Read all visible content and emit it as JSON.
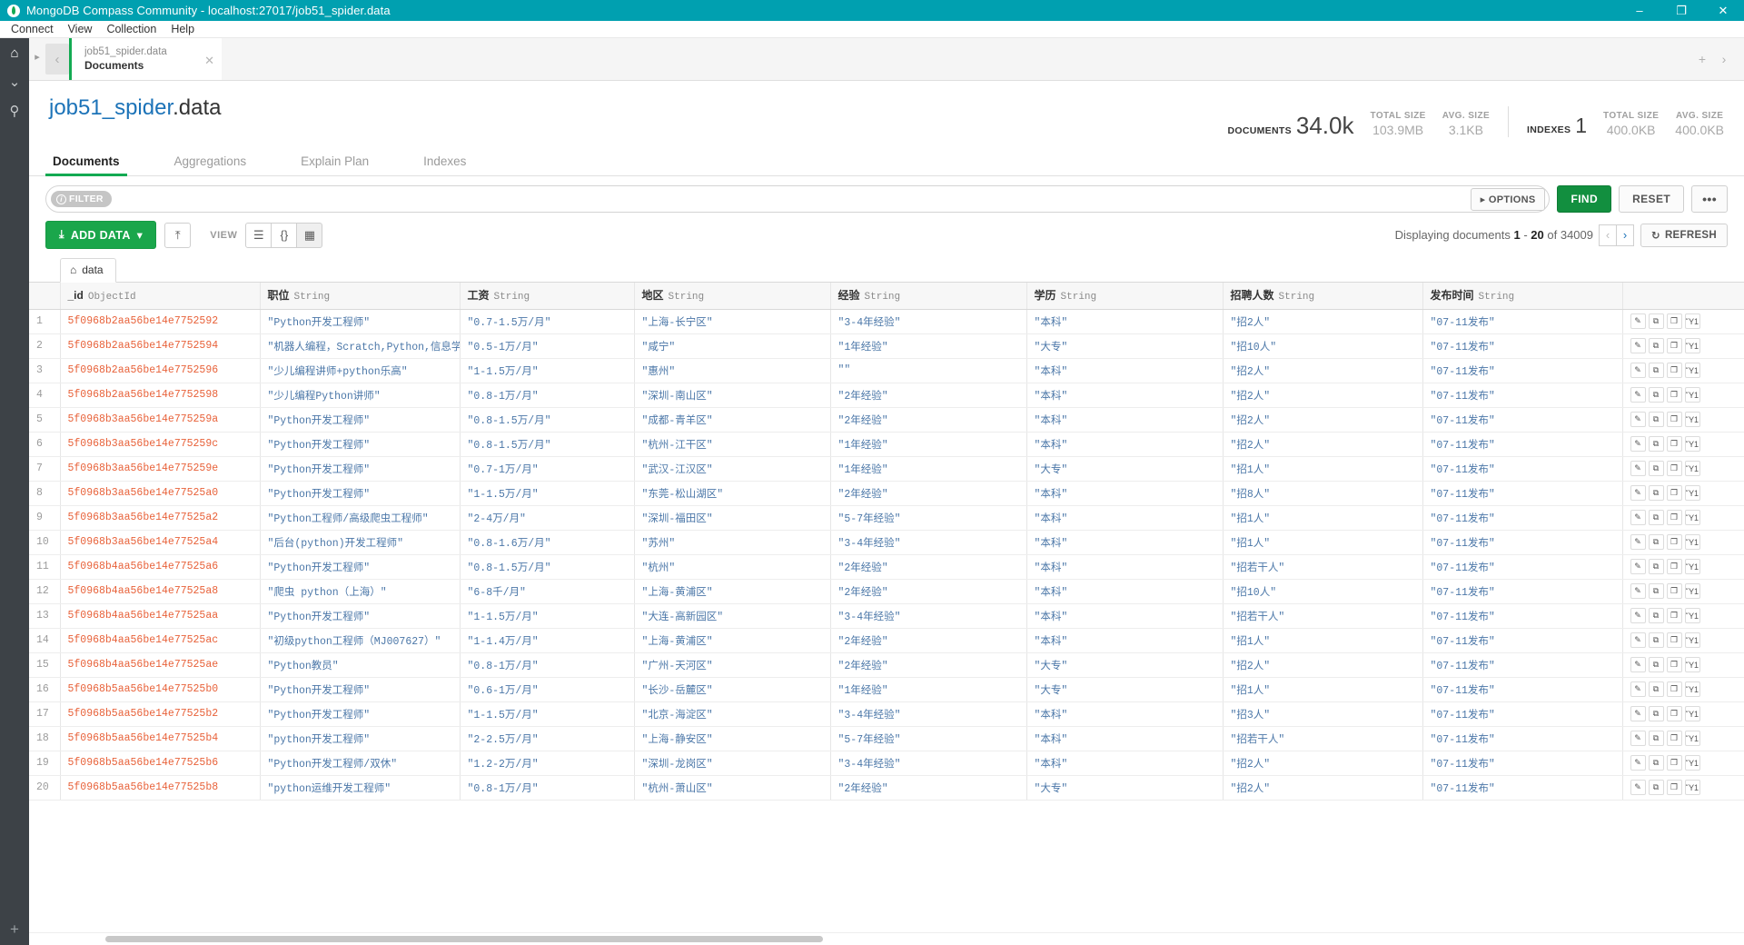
{
  "window": {
    "title": "MongoDB Compass Community - localhost:27017/job51_spider.data",
    "minimize": "–",
    "maximize": "❐",
    "close": "✕"
  },
  "menubar": {
    "items": [
      "Connect",
      "View",
      "Collection",
      "Help"
    ]
  },
  "rail": {
    "home_icon": "⌂",
    "chevron_icon": "⌄",
    "search_icon": "⚲",
    "plus_icon": "+"
  },
  "tabstrip": {
    "nav_forward_icon": "▸",
    "back_icon": "‹",
    "tab": {
      "namespace": "job51_spider.data",
      "subview": "Documents",
      "close_icon": "✕"
    },
    "right_add_icon": "+",
    "right_next_icon": "›"
  },
  "collection": {
    "db": "job51_spider",
    "coll": ".data",
    "stats": {
      "documents_label": "DOCUMENTS",
      "documents_value": "34.0k",
      "doc_total_size_label": "TOTAL SIZE",
      "doc_total_size_value": "103.9MB",
      "doc_avg_size_label": "AVG. SIZE",
      "doc_avg_size_value": "3.1KB",
      "indexes_label": "INDEXES",
      "indexes_value": "1",
      "idx_total_size_label": "TOTAL SIZE",
      "idx_total_size_value": "400.0KB",
      "idx_avg_size_label": "AVG. SIZE",
      "idx_avg_size_value": "400.0KB"
    }
  },
  "view_tabs": [
    {
      "label": "Documents",
      "active": true
    },
    {
      "label": "Aggregations",
      "active": false
    },
    {
      "label": "Explain Plan",
      "active": false
    },
    {
      "label": "Indexes",
      "active": false
    }
  ],
  "query_bar": {
    "filter_badge": "FILTER",
    "filter_info_icon": "i",
    "filter_value": "",
    "filter_placeholder": "",
    "options_label": "OPTIONS",
    "options_caret": "▸",
    "find_label": "FIND",
    "reset_label": "RESET",
    "more_label": "•••"
  },
  "toolbar": {
    "add_data_label": "ADD DATA",
    "add_data_icon": "⤓",
    "add_data_caret": "▾",
    "export_icon": "⤒",
    "view_label": "VIEW",
    "view_modes": [
      {
        "name": "list-view",
        "icon": "☰",
        "selected": false
      },
      {
        "name": "json-view",
        "icon": "{}",
        "selected": false
      },
      {
        "name": "table-view",
        "icon": "▦",
        "selected": true
      }
    ],
    "displaying_prefix": "Displaying documents",
    "range_start": "1",
    "range_dash": "-",
    "range_end": "20",
    "of_label": "of",
    "total": "34009",
    "prev_icon": "‹",
    "next_icon": "›",
    "refresh_icon": "↻",
    "refresh_label": "REFRESH"
  },
  "doc_tab": {
    "icon": "⌂",
    "label": "data"
  },
  "table": {
    "row_action_icons": [
      "edit-pencil",
      "clone",
      "copy",
      "delete"
    ],
    "action_glyphs": [
      "✎",
      "⧉",
      "❐",
      "Ὕ1"
    ],
    "columns": [
      {
        "name": "_id",
        "type": "ObjectId"
      },
      {
        "name": "职位",
        "type": "String"
      },
      {
        "name": "工资",
        "type": "String"
      },
      {
        "name": "地区",
        "type": "String"
      },
      {
        "name": "经验",
        "type": "String"
      },
      {
        "name": "学历",
        "type": "String"
      },
      {
        "name": "招聘人数",
        "type": "String"
      },
      {
        "name": "发布时间",
        "type": "String"
      }
    ],
    "rows": [
      {
        "n": "1",
        "id": "5f0968b2aa56be14e7752592",
        "c1": "\"Python开发工程师\"",
        "c2": "\"0.7-1.5万/月\"",
        "c3": "\"上海-长宁区\"",
        "c4": "\"3-4年经验\"",
        "c5": "\"本科\"",
        "c6": "\"招2人\"",
        "c7": "\"07-11发布\""
      },
      {
        "n": "2",
        "id": "5f0968b2aa56be14e7752594",
        "c1": "\"机器人编程，Scratch,Python,信息学\"",
        "c2": "\"0.5-1万/月\"",
        "c3": "\"咸宁\"",
        "c4": "\"1年经验\"",
        "c5": "\"大专\"",
        "c6": "\"招10人\"",
        "c7": "\"07-11发布\""
      },
      {
        "n": "3",
        "id": "5f0968b2aa56be14e7752596",
        "c1": "\"少儿编程讲师+python乐高\"",
        "c2": "\"1-1.5万/月\"",
        "c3": "\"惠州\"",
        "c4": "\"\"",
        "c5": "\"本科\"",
        "c6": "\"招2人\"",
        "c7": "\"07-11发布\""
      },
      {
        "n": "4",
        "id": "5f0968b2aa56be14e7752598",
        "c1": "\"少儿编程Python讲师\"",
        "c2": "\"0.8-1万/月\"",
        "c3": "\"深圳-南山区\"",
        "c4": "\"2年经验\"",
        "c5": "\"本科\"",
        "c6": "\"招2人\"",
        "c7": "\"07-11发布\""
      },
      {
        "n": "5",
        "id": "5f0968b3aa56be14e775259a",
        "c1": "\"Python开发工程师\"",
        "c2": "\"0.8-1.5万/月\"",
        "c3": "\"成都-青羊区\"",
        "c4": "\"2年经验\"",
        "c5": "\"本科\"",
        "c6": "\"招2人\"",
        "c7": "\"07-11发布\""
      },
      {
        "n": "6",
        "id": "5f0968b3aa56be14e775259c",
        "c1": "\"Python开发工程师\"",
        "c2": "\"0.8-1.5万/月\"",
        "c3": "\"杭州-江干区\"",
        "c4": "\"1年经验\"",
        "c5": "\"本科\"",
        "c6": "\"招2人\"",
        "c7": "\"07-11发布\""
      },
      {
        "n": "7",
        "id": "5f0968b3aa56be14e775259e",
        "c1": "\"Python开发工程师\"",
        "c2": "\"0.7-1万/月\"",
        "c3": "\"武汉-江汉区\"",
        "c4": "\"1年经验\"",
        "c5": "\"大专\"",
        "c6": "\"招1人\"",
        "c7": "\"07-11发布\""
      },
      {
        "n": "8",
        "id": "5f0968b3aa56be14e77525a0",
        "c1": "\"Python开发工程师\"",
        "c2": "\"1-1.5万/月\"",
        "c3": "\"东莞-松山湖区\"",
        "c4": "\"2年经验\"",
        "c5": "\"本科\"",
        "c6": "\"招8人\"",
        "c7": "\"07-11发布\""
      },
      {
        "n": "9",
        "id": "5f0968b3aa56be14e77525a2",
        "c1": "\"Python工程师/高级爬虫工程师\"",
        "c2": "\"2-4万/月\"",
        "c3": "\"深圳-福田区\"",
        "c4": "\"5-7年经验\"",
        "c5": "\"本科\"",
        "c6": "\"招1人\"",
        "c7": "\"07-11发布\""
      },
      {
        "n": "10",
        "id": "5f0968b3aa56be14e77525a4",
        "c1": "\"后台(python)开发工程师\"",
        "c2": "\"0.8-1.6万/月\"",
        "c3": "\"苏州\"",
        "c4": "\"3-4年经验\"",
        "c5": "\"本科\"",
        "c6": "\"招1人\"",
        "c7": "\"07-11发布\""
      },
      {
        "n": "11",
        "id": "5f0968b4aa56be14e77525a6",
        "c1": "\"Python开发工程师\"",
        "c2": "\"0.8-1.5万/月\"",
        "c3": "\"杭州\"",
        "c4": "\"2年经验\"",
        "c5": "\"本科\"",
        "c6": "\"招若干人\"",
        "c7": "\"07-11发布\""
      },
      {
        "n": "12",
        "id": "5f0968b4aa56be14e77525a8",
        "c1": "\"爬虫 python（上海）\"",
        "c2": "\"6-8千/月\"",
        "c3": "\"上海-黄浦区\"",
        "c4": "\"2年经验\"",
        "c5": "\"本科\"",
        "c6": "\"招10人\"",
        "c7": "\"07-11发布\""
      },
      {
        "n": "13",
        "id": "5f0968b4aa56be14e77525aa",
        "c1": "\"Python开发工程师\"",
        "c2": "\"1-1.5万/月\"",
        "c3": "\"大连-高新园区\"",
        "c4": "\"3-4年经验\"",
        "c5": "\"本科\"",
        "c6": "\"招若干人\"",
        "c7": "\"07-11发布\""
      },
      {
        "n": "14",
        "id": "5f0968b4aa56be14e77525ac",
        "c1": "\"初级python工程师（MJ007627）\"",
        "c2": "\"1-1.4万/月\"",
        "c3": "\"上海-黄浦区\"",
        "c4": "\"2年经验\"",
        "c5": "\"本科\"",
        "c6": "\"招1人\"",
        "c7": "\"07-11发布\""
      },
      {
        "n": "15",
        "id": "5f0968b4aa56be14e77525ae",
        "c1": "\"Python教员\"",
        "c2": "\"0.8-1万/月\"",
        "c3": "\"广州-天河区\"",
        "c4": "\"2年经验\"",
        "c5": "\"大专\"",
        "c6": "\"招2人\"",
        "c7": "\"07-11发布\""
      },
      {
        "n": "16",
        "id": "5f0968b5aa56be14e77525b0",
        "c1": "\"Python开发工程师\"",
        "c2": "\"0.6-1万/月\"",
        "c3": "\"长沙-岳麓区\"",
        "c4": "\"1年经验\"",
        "c5": "\"大专\"",
        "c6": "\"招1人\"",
        "c7": "\"07-11发布\""
      },
      {
        "n": "17",
        "id": "5f0968b5aa56be14e77525b2",
        "c1": "\"Python开发工程师\"",
        "c2": "\"1-1.5万/月\"",
        "c3": "\"北京-海淀区\"",
        "c4": "\"3-4年经验\"",
        "c5": "\"本科\"",
        "c6": "\"招3人\"",
        "c7": "\"07-11发布\""
      },
      {
        "n": "18",
        "id": "5f0968b5aa56be14e77525b4",
        "c1": "\"python开发工程师\"",
        "c2": "\"2-2.5万/月\"",
        "c3": "\"上海-静安区\"",
        "c4": "\"5-7年经验\"",
        "c5": "\"本科\"",
        "c6": "\"招若干人\"",
        "c7": "\"07-11发布\""
      },
      {
        "n": "19",
        "id": "5f0968b5aa56be14e77525b6",
        "c1": "\"Python开发工程师/双休\"",
        "c2": "\"1.2-2万/月\"",
        "c3": "\"深圳-龙岗区\"",
        "c4": "\"3-4年经验\"",
        "c5": "\"本科\"",
        "c6": "\"招2人\"",
        "c7": "\"07-11发布\""
      },
      {
        "n": "20",
        "id": "5f0968b5aa56be14e77525b8",
        "c1": "\"python运维开发工程师\"",
        "c2": "\"0.8-1万/月\"",
        "c3": "\"杭州-萧山区\"",
        "c4": "\"2年经验\"",
        "c5": "\"大专\"",
        "c6": "\"招2人\"",
        "c7": "\"07-11发布\""
      }
    ]
  },
  "colors": {
    "brand_green": "#13aa52",
    "titlebar": "#00a0b0",
    "oid": "#e8623a",
    "string": "#4b77a8"
  }
}
